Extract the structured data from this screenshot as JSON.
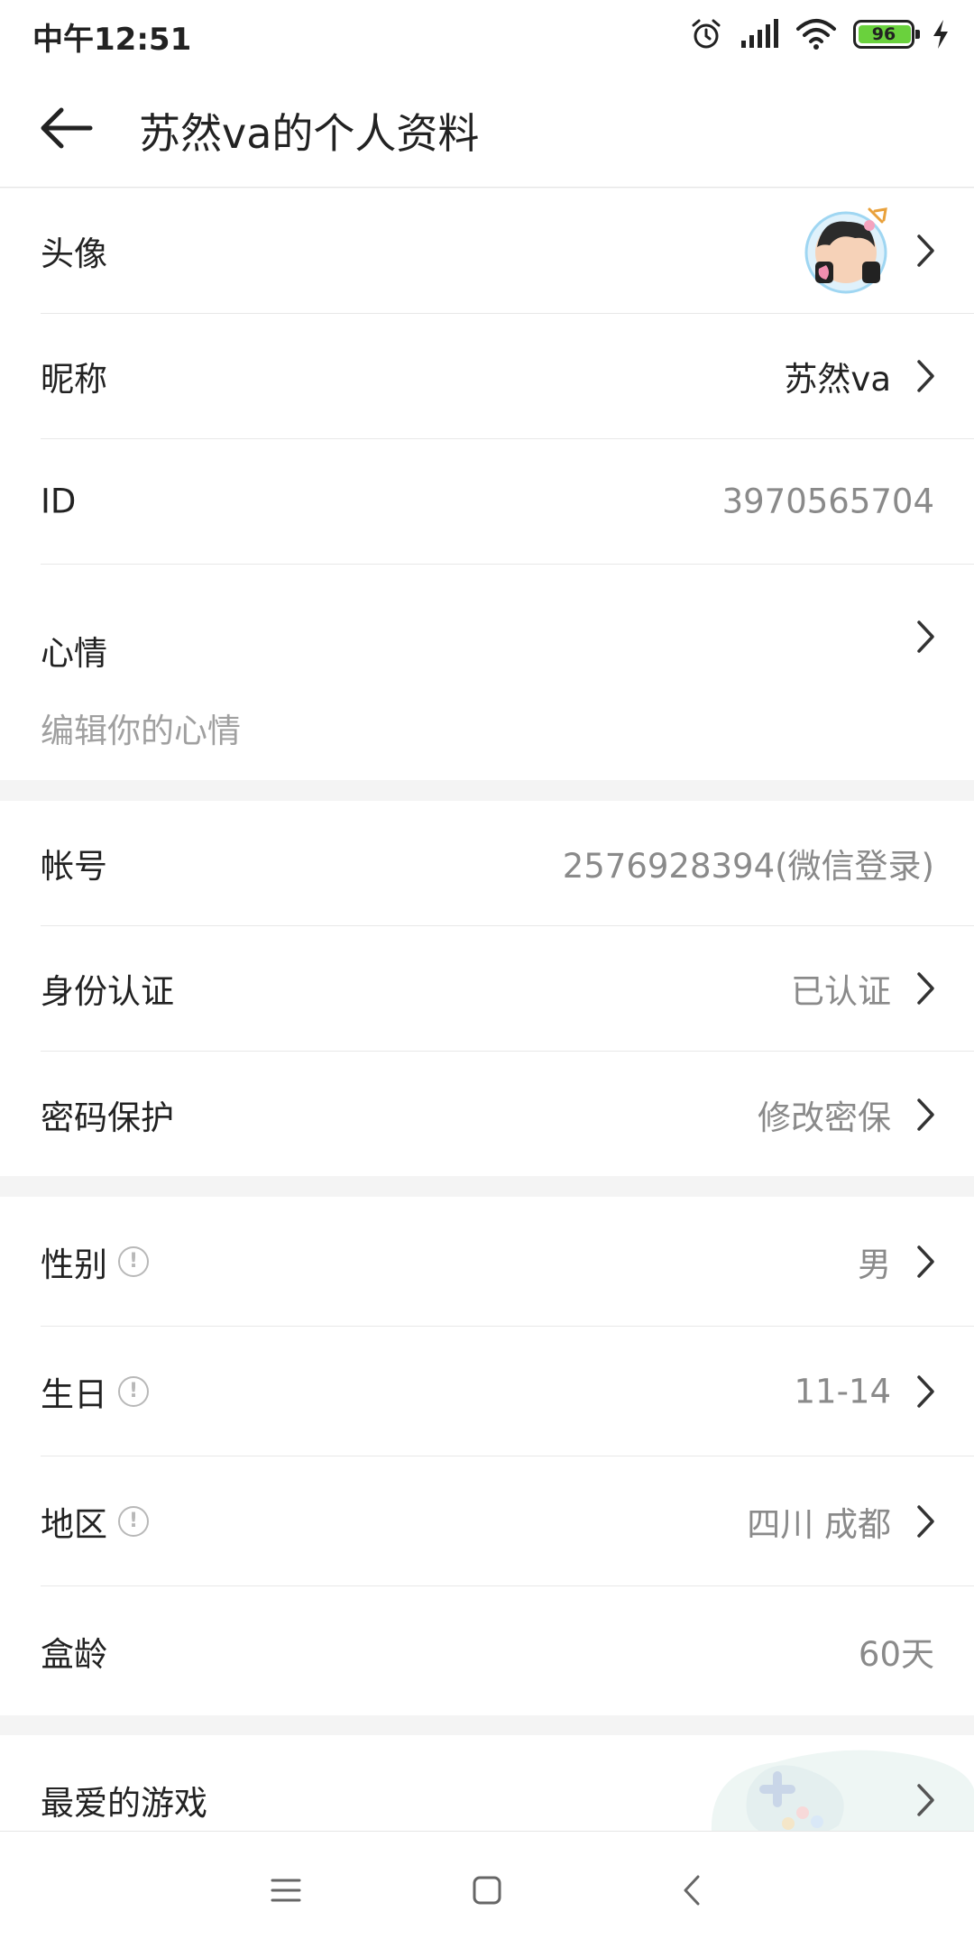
{
  "status_bar": {
    "time": "中午12:51",
    "battery": "96",
    "icons": [
      "alarm-icon",
      "signal-icon",
      "wifi-icon",
      "battery-icon",
      "charging-icon"
    ]
  },
  "header": {
    "title": "苏然va的个人资料",
    "back_icon": "back-arrow-icon"
  },
  "profile": {
    "avatar_label": "头像",
    "nickname_label": "昵称",
    "nickname_value": "苏然va",
    "id_label": "ID",
    "id_value": "3970565704",
    "mood_label": "心情",
    "mood_hint": "编辑你的心情"
  },
  "account": {
    "account_label": "帐号",
    "account_value": "2576928394(微信登录)",
    "identity_label": "身份认证",
    "identity_value": "已认证",
    "password_label": "密码保护",
    "password_value": "修改密保"
  },
  "details": {
    "gender_label": "性别",
    "gender_value": "男",
    "birthday_label": "生日",
    "birthday_value": "11-14",
    "region_label": "地区",
    "region_value": "四川 成都",
    "box_age_label": "盒龄",
    "box_age_value": "60天"
  },
  "games": {
    "favorite_label": "最爱的游戏"
  },
  "colors": {
    "battery_fill": "#6ad13d",
    "section_gap": "#f4f4f4",
    "value_gray": "#8a8a8a"
  },
  "nav_bar": {
    "icons": [
      "menu-icon",
      "home-icon",
      "back-icon"
    ]
  }
}
